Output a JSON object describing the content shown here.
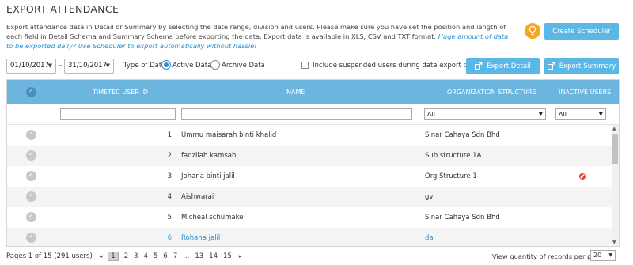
{
  "page": {
    "title": "EXPORT ATTENDANCE",
    "description": "Export attendance data in Detail or Summary by selecting the date range, division and users. Please make sure you have set the position and length of each field in Detail Schema and Summary Schema before exporting the data. Export data is available in XLS, CSV and TXT format.",
    "description_link": "Huge amount of data to be exported daily? Use Scheduler to export automatically without hassle!"
  },
  "icons": {
    "bulb": "lightbulb-icon",
    "scheduler": "calendar-icon",
    "export": "export-icon"
  },
  "colors": {
    "accent": "#5bb8e6",
    "header": "#6bb5df",
    "link": "#2f8fcf",
    "bulb": "#f5a623",
    "inactive": "#e03a3a"
  },
  "toolbar": {
    "create_scheduler": "Create Scheduler",
    "date_from": "01/10/2017",
    "date_sep": "-",
    "date_to": "31/10/2017",
    "type_label": "Type of Data",
    "active_data": "Active Data",
    "archive_data": "Archive Data",
    "include_suspended": "Include suspended users during data export process",
    "export_detail": "Export Detail",
    "export_summary": "Export Summary"
  },
  "grid": {
    "columns": [
      "TIMETEC USER ID",
      "NAME",
      "ORGANIZATION STRUCTURE",
      "INACTIVE USERS"
    ],
    "filter_org": "All",
    "filter_inactive": "All",
    "rows": [
      {
        "id": "1",
        "name": "Ummu maisarah binti khalid",
        "org": "Sinar Cahaya Sdn Bhd",
        "inactive": false
      },
      {
        "id": "2",
        "name": "fadzilah kamsah",
        "org": "Sub structure 1A",
        "inactive": false
      },
      {
        "id": "3",
        "name": "Johana binti jalil",
        "org": "Org Structure 1",
        "inactive": true
      },
      {
        "id": "4",
        "name": "Aishwarai",
        "org": "gv",
        "inactive": false
      },
      {
        "id": "5",
        "name": "Micheal schumakel",
        "org": "Sinar Cahaya Sdn Bhd",
        "inactive": false
      },
      {
        "id": "6",
        "name": "Rohana jalil",
        "org": "da",
        "inactive": false
      }
    ]
  },
  "pager": {
    "summary": "Pages 1 of 15 (291 users)",
    "prev": "◂",
    "next": "▸",
    "pages": [
      "1",
      "2",
      "3",
      "4",
      "5",
      "6",
      "7",
      "...",
      "13",
      "14",
      "15"
    ],
    "per_page_label": "View quantity of records per page",
    "per_page_value": "20"
  }
}
